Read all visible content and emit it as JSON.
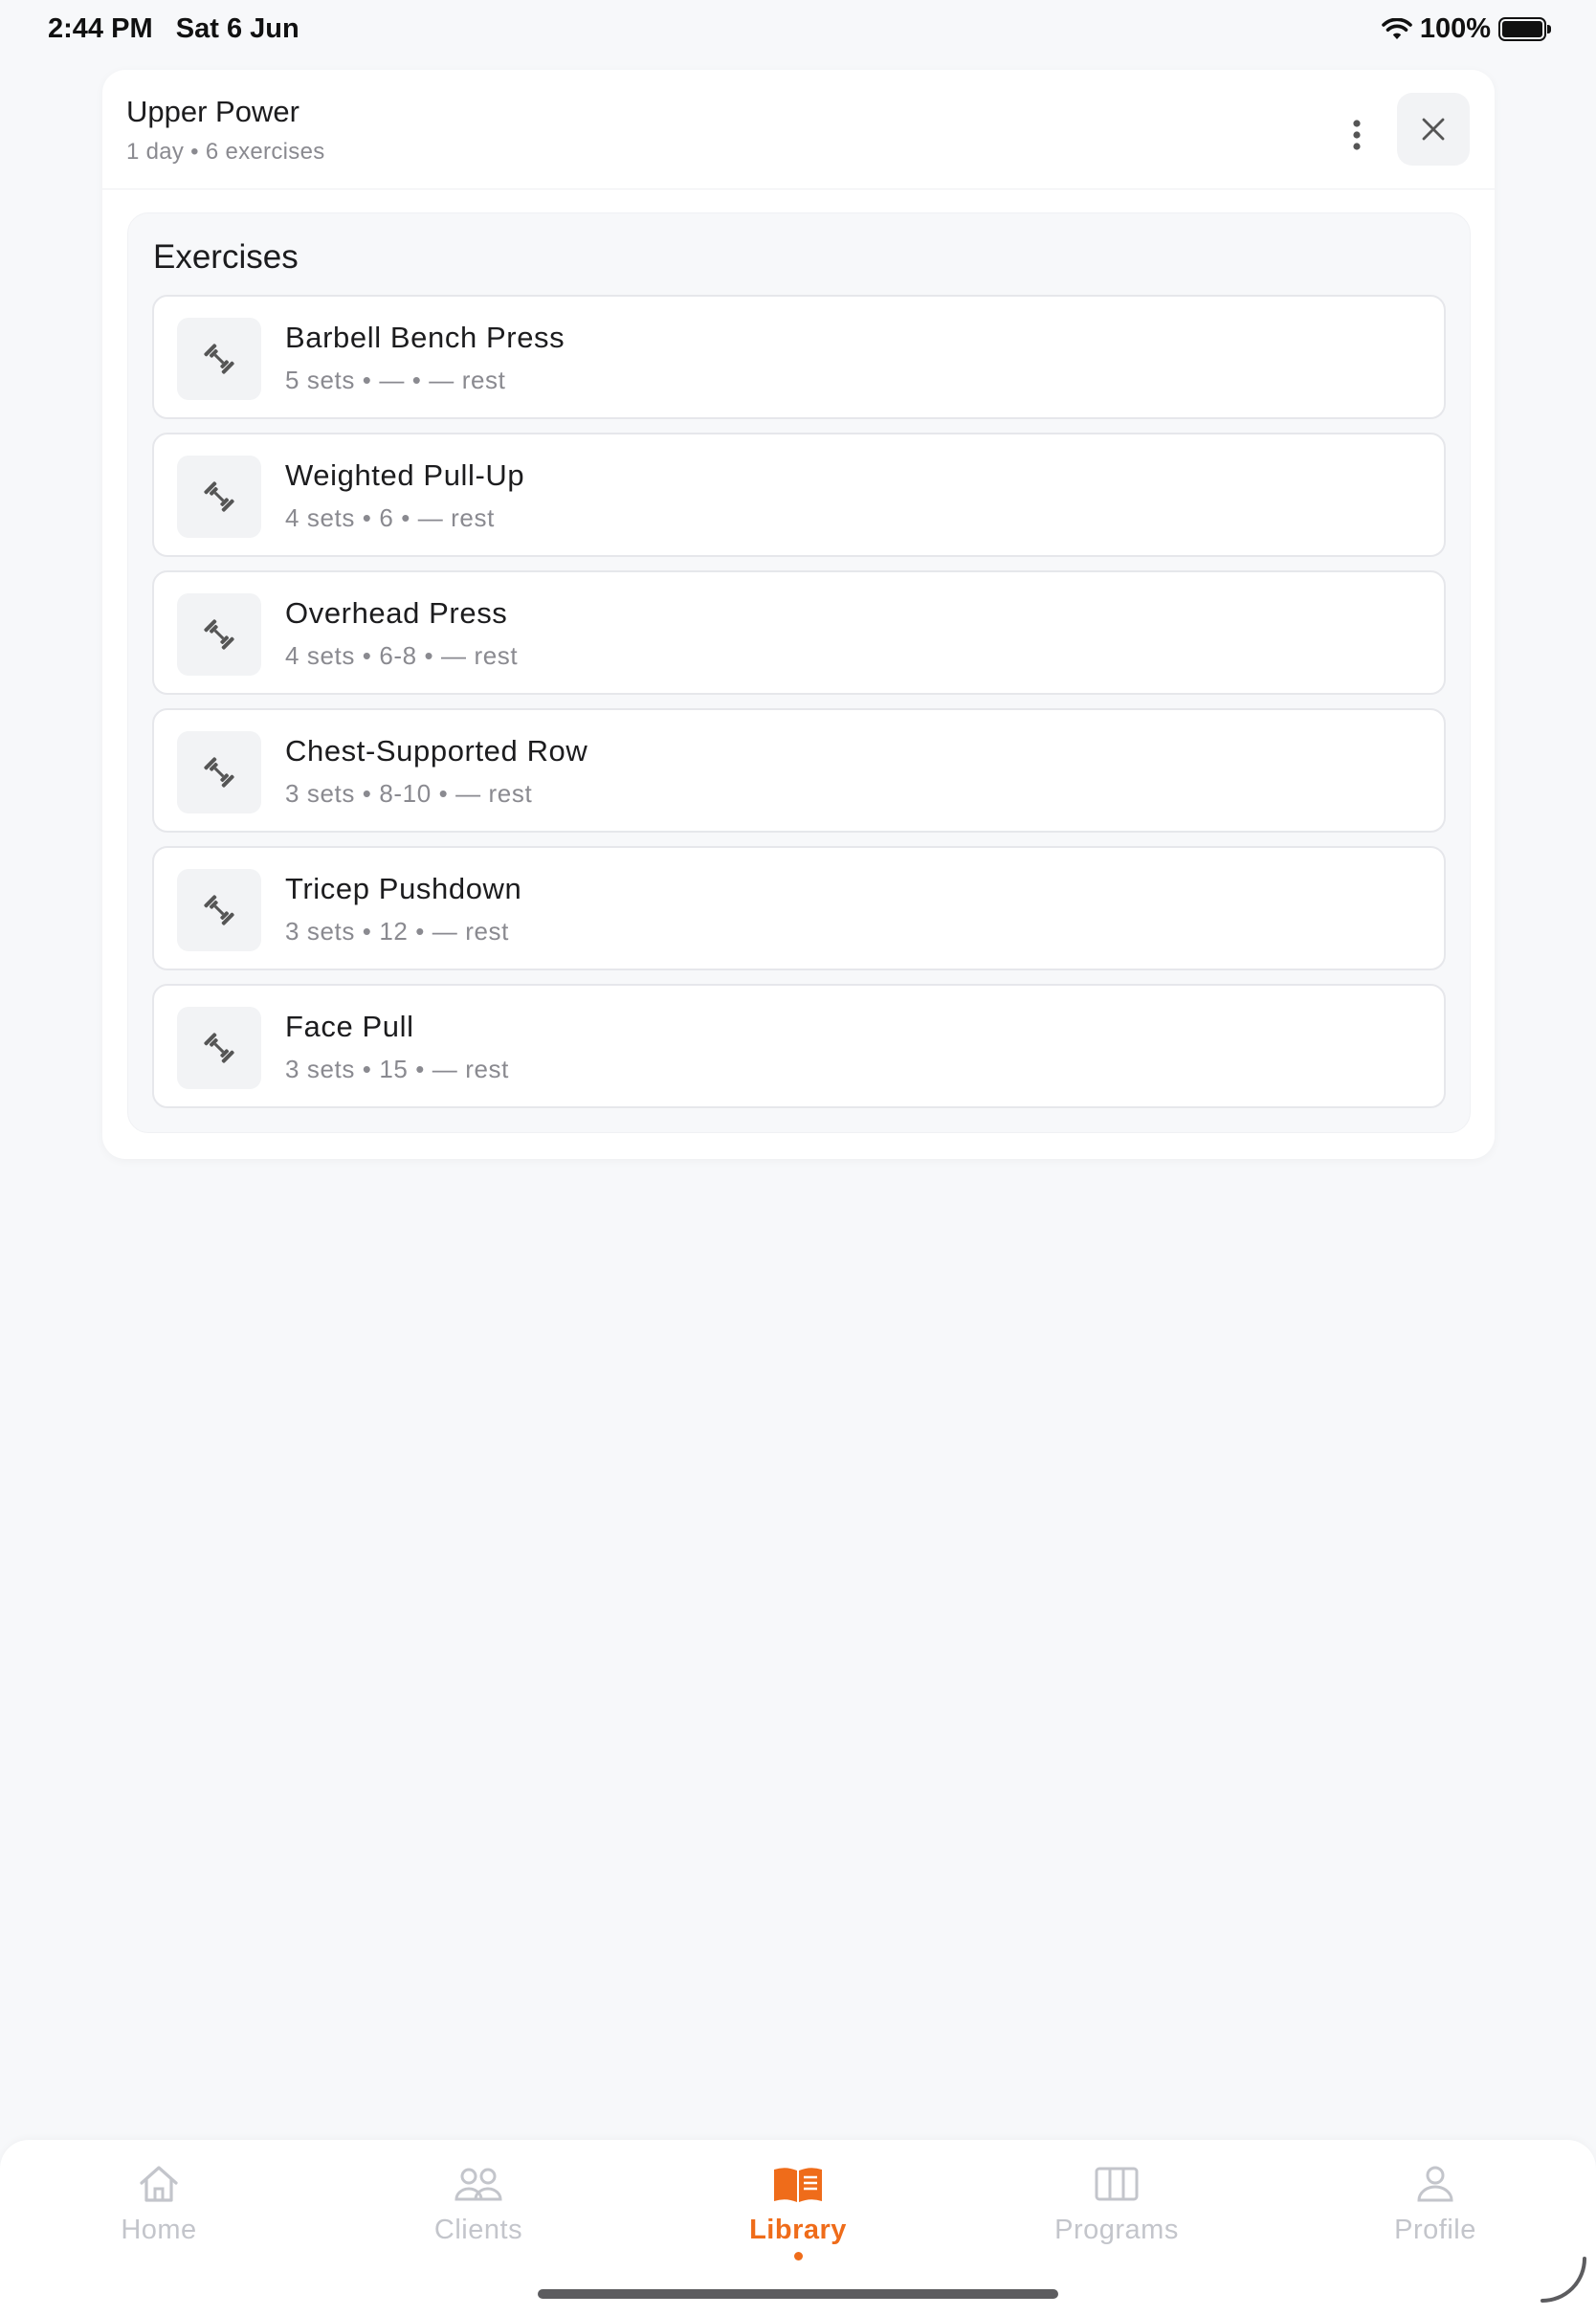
{
  "status_bar": {
    "time": "2:44 PM",
    "date": "Sat 6 Jun",
    "battery": "100%",
    "battery_level": 1.0
  },
  "program": {
    "title": "Upper Power",
    "subtitle": "1 day • 6 exercises",
    "more_icon": "more-vertical-icon",
    "close_icon": "close-icon"
  },
  "exercises": {
    "heading": "Exercises",
    "icon": "dumbbell-icon",
    "items": [
      {
        "name": "Barbell Bench Press",
        "meta": "5 sets • — • — rest"
      },
      {
        "name": "Weighted Pull-Up",
        "meta": "4 sets • 6 • — rest"
      },
      {
        "name": "Overhead Press",
        "meta": "4 sets • 6-8 • — rest"
      },
      {
        "name": "Chest-Supported Row",
        "meta": "3 sets • 8-10 • — rest"
      },
      {
        "name": "Tricep Pushdown",
        "meta": "3 sets • 12 • — rest"
      },
      {
        "name": "Face Pull",
        "meta": "3 sets • 15 • — rest"
      }
    ]
  },
  "tab_bar": {
    "accent_color": "#ef6c1a",
    "inactive_color": "#c3c5cb",
    "tabs": [
      {
        "label": "Home",
        "icon": "home-icon",
        "active": false
      },
      {
        "label": "Clients",
        "icon": "users-icon",
        "active": false
      },
      {
        "label": "Library",
        "icon": "book-icon",
        "active": true
      },
      {
        "label": "Programs",
        "icon": "columns-icon",
        "active": false
      },
      {
        "label": "Profile",
        "icon": "user-icon",
        "active": false
      }
    ]
  }
}
